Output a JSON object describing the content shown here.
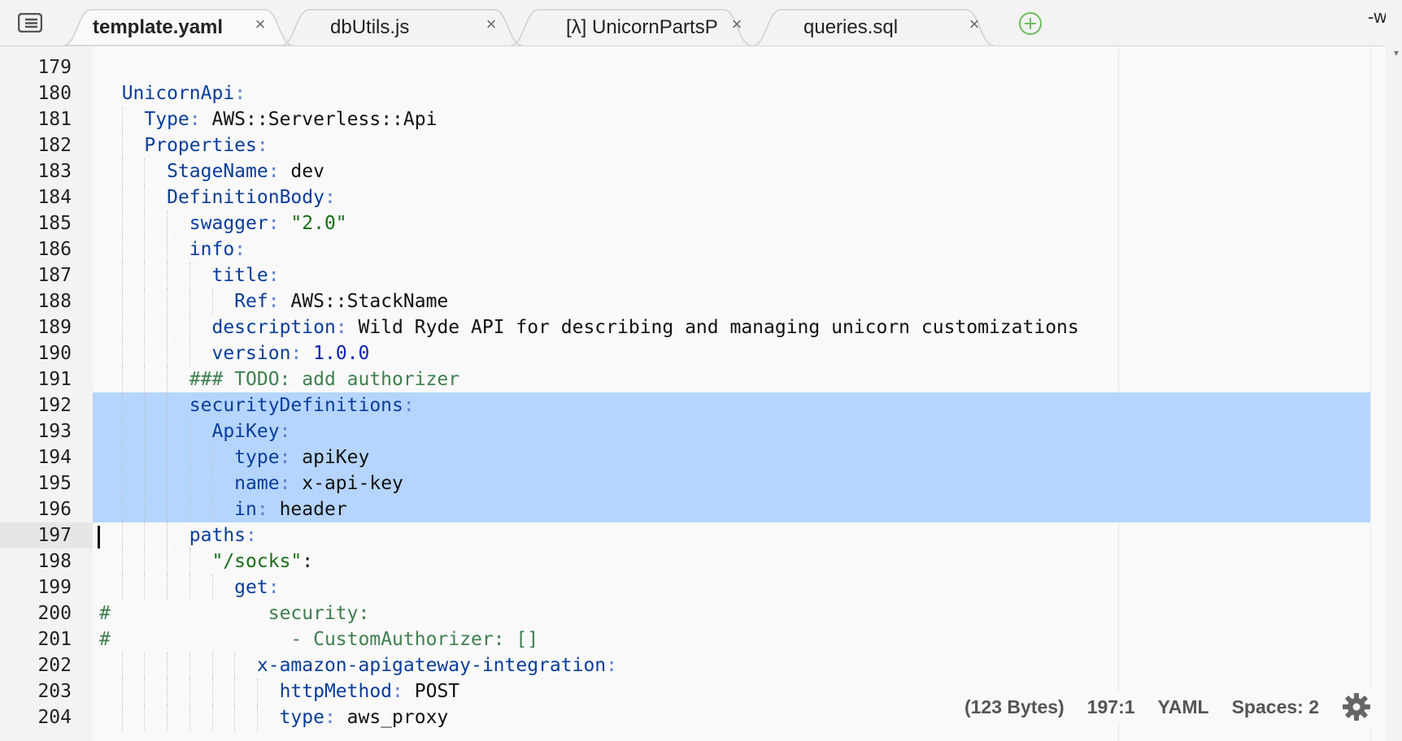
{
  "tabs": [
    {
      "label": "template.yaml",
      "active": true
    },
    {
      "label": "dbUtils.js",
      "active": false
    },
    {
      "label": "[λ] UnicornPartsP",
      "active": false
    },
    {
      "label": "queries.sql",
      "active": false
    }
  ],
  "tab_close_glyph": "×",
  "right_edge_text": "-w",
  "right_edge_arrow": "▾",
  "icons": {
    "menu": "list-icon",
    "add_tab": "plus-circle-icon",
    "settings": "gear-icon",
    "close": "close-icon"
  },
  "colors": {
    "selection": "#b5d5ff",
    "add_tab": "#6cbf5a"
  },
  "editor": {
    "current_line": 197,
    "selected_lines": [
      192,
      193,
      194,
      195,
      196
    ],
    "lines": [
      {
        "n": "179",
        "tokens": [
          {
            "t": "",
            "c": "txt"
          }
        ]
      },
      {
        "n": "180",
        "tokens": [
          {
            "t": "  ",
            "c": "txt"
          },
          {
            "t": "UnicornApi",
            "c": "key"
          },
          {
            "t": ":",
            "c": "p"
          }
        ]
      },
      {
        "n": "181",
        "tokens": [
          {
            "t": "    ",
            "c": "txt"
          },
          {
            "t": "Type",
            "c": "key"
          },
          {
            "t": ": ",
            "c": "p"
          },
          {
            "t": "AWS::Serverless::Api",
            "c": "txt"
          }
        ]
      },
      {
        "n": "182",
        "tokens": [
          {
            "t": "    ",
            "c": "txt"
          },
          {
            "t": "Properties",
            "c": "key"
          },
          {
            "t": ":",
            "c": "p"
          }
        ]
      },
      {
        "n": "183",
        "tokens": [
          {
            "t": "      ",
            "c": "txt"
          },
          {
            "t": "StageName",
            "c": "key"
          },
          {
            "t": ": ",
            "c": "p"
          },
          {
            "t": "dev",
            "c": "txt"
          }
        ]
      },
      {
        "n": "184",
        "tokens": [
          {
            "t": "      ",
            "c": "txt"
          },
          {
            "t": "DefinitionBody",
            "c": "key"
          },
          {
            "t": ":",
            "c": "p"
          }
        ]
      },
      {
        "n": "185",
        "tokens": [
          {
            "t": "        ",
            "c": "txt"
          },
          {
            "t": "swagger",
            "c": "key"
          },
          {
            "t": ": ",
            "c": "p"
          },
          {
            "t": "\"2.0\"",
            "c": "str"
          }
        ]
      },
      {
        "n": "186",
        "tokens": [
          {
            "t": "        ",
            "c": "txt"
          },
          {
            "t": "info",
            "c": "key"
          },
          {
            "t": ":",
            "c": "p"
          }
        ]
      },
      {
        "n": "187",
        "tokens": [
          {
            "t": "          ",
            "c": "txt"
          },
          {
            "t": "title",
            "c": "key"
          },
          {
            "t": ":",
            "c": "p"
          }
        ]
      },
      {
        "n": "188",
        "tokens": [
          {
            "t": "            ",
            "c": "txt"
          },
          {
            "t": "Ref",
            "c": "key"
          },
          {
            "t": ": ",
            "c": "p"
          },
          {
            "t": "AWS::StackName",
            "c": "txt"
          }
        ]
      },
      {
        "n": "189",
        "tokens": [
          {
            "t": "          ",
            "c": "txt"
          },
          {
            "t": "description",
            "c": "key"
          },
          {
            "t": ": ",
            "c": "p"
          },
          {
            "t": "Wild Ryde API for describing and managing unicorn customizations",
            "c": "txt"
          }
        ]
      },
      {
        "n": "190",
        "tokens": [
          {
            "t": "          ",
            "c": "txt"
          },
          {
            "t": "version",
            "c": "key"
          },
          {
            "t": ": ",
            "c": "p"
          },
          {
            "t": "1.0.0",
            "c": "num"
          }
        ]
      },
      {
        "n": "191",
        "tokens": [
          {
            "t": "        ",
            "c": "txt"
          },
          {
            "t": "### TODO: add authorizer",
            "c": "com"
          }
        ]
      },
      {
        "n": "192",
        "tokens": [
          {
            "t": "        ",
            "c": "txt"
          },
          {
            "t": "securityDefinitions",
            "c": "key"
          },
          {
            "t": ":",
            "c": "p"
          }
        ]
      },
      {
        "n": "193",
        "tokens": [
          {
            "t": "          ",
            "c": "txt"
          },
          {
            "t": "ApiKey",
            "c": "key"
          },
          {
            "t": ":",
            "c": "p"
          }
        ]
      },
      {
        "n": "194",
        "tokens": [
          {
            "t": "            ",
            "c": "txt"
          },
          {
            "t": "type",
            "c": "key"
          },
          {
            "t": ": ",
            "c": "p"
          },
          {
            "t": "apiKey",
            "c": "txt"
          }
        ]
      },
      {
        "n": "195",
        "tokens": [
          {
            "t": "            ",
            "c": "txt"
          },
          {
            "t": "name",
            "c": "key"
          },
          {
            "t": ": ",
            "c": "p"
          },
          {
            "t": "x-api-key",
            "c": "txt"
          }
        ]
      },
      {
        "n": "196",
        "tokens": [
          {
            "t": "            ",
            "c": "txt"
          },
          {
            "t": "in",
            "c": "key"
          },
          {
            "t": ": ",
            "c": "p"
          },
          {
            "t": "header",
            "c": "txt"
          }
        ]
      },
      {
        "n": "197",
        "tokens": [
          {
            "t": "        ",
            "c": "txt"
          },
          {
            "t": "paths",
            "c": "key"
          },
          {
            "t": ":",
            "c": "p"
          }
        ]
      },
      {
        "n": "198",
        "tokens": [
          {
            "t": "          ",
            "c": "txt"
          },
          {
            "t": "\"/socks\"",
            "c": "str"
          },
          {
            "t": ":",
            "c": "txt"
          }
        ]
      },
      {
        "n": "199",
        "tokens": [
          {
            "t": "            ",
            "c": "txt"
          },
          {
            "t": "get",
            "c": "key"
          },
          {
            "t": ":",
            "c": "p"
          }
        ]
      },
      {
        "n": "200",
        "tokens": [
          {
            "t": "#",
            "c": "com"
          },
          {
            "t": "              security:",
            "c": "com"
          }
        ]
      },
      {
        "n": "201",
        "tokens": [
          {
            "t": "#",
            "c": "com"
          },
          {
            "t": "                - CustomAuthorizer: []",
            "c": "com"
          }
        ]
      },
      {
        "n": "202",
        "tokens": [
          {
            "t": "              ",
            "c": "txt"
          },
          {
            "t": "x-amazon-apigateway-integration",
            "c": "key"
          },
          {
            "t": ":",
            "c": "p"
          }
        ]
      },
      {
        "n": "203",
        "tokens": [
          {
            "t": "                ",
            "c": "txt"
          },
          {
            "t": "httpMethod",
            "c": "key"
          },
          {
            "t": ": ",
            "c": "p"
          },
          {
            "t": "POST",
            "c": "txt"
          }
        ]
      },
      {
        "n": "204",
        "tokens": [
          {
            "t": "                ",
            "c": "txt"
          },
          {
            "t": "type",
            "c": "key"
          },
          {
            "t": ": ",
            "c": "p"
          },
          {
            "t": "aws_proxy",
            "c": "txt"
          }
        ]
      }
    ]
  },
  "status": {
    "size": "(123 Bytes)",
    "position": "197:1",
    "mode": "YAML",
    "indent": "Spaces: 2"
  }
}
